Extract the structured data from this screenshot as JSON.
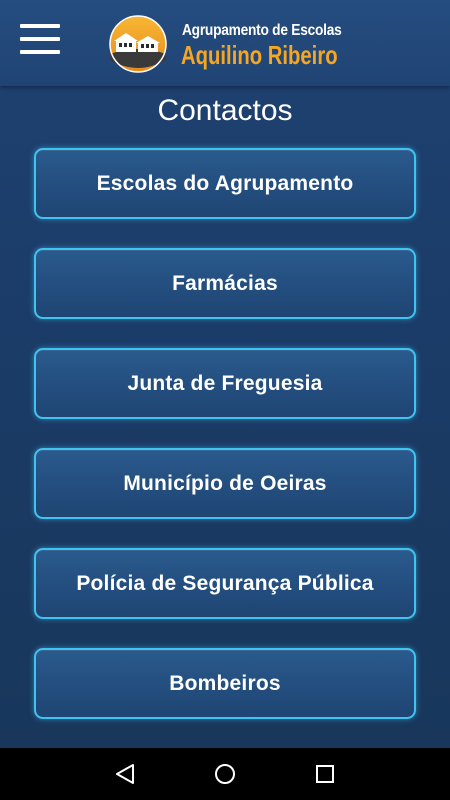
{
  "header": {
    "menu_icon": "hamburger-menu-icon",
    "logo_icon": "school-building-logo",
    "brand_line1": "Agrupamento de Escolas",
    "brand_line2": "Aquilino Ribeiro",
    "brand_line2_color": "#f5a623"
  },
  "page": {
    "title": "Contactos"
  },
  "contacts": [
    {
      "label": "Escolas do Agrupamento"
    },
    {
      "label": "Farmácias"
    },
    {
      "label": "Junta de Freguesia"
    },
    {
      "label": "Município de Oeiras"
    },
    {
      "label": "Polícia de Segurança Pública"
    },
    {
      "label": "Bombeiros"
    }
  ],
  "navbar": {
    "back_icon": "back-triangle-icon",
    "home_icon": "home-circle-icon",
    "recent_icon": "recent-apps-square-icon"
  },
  "colors": {
    "background": "#1c3d69",
    "button_border": "#3fc3f0",
    "text": "#ffffff"
  }
}
